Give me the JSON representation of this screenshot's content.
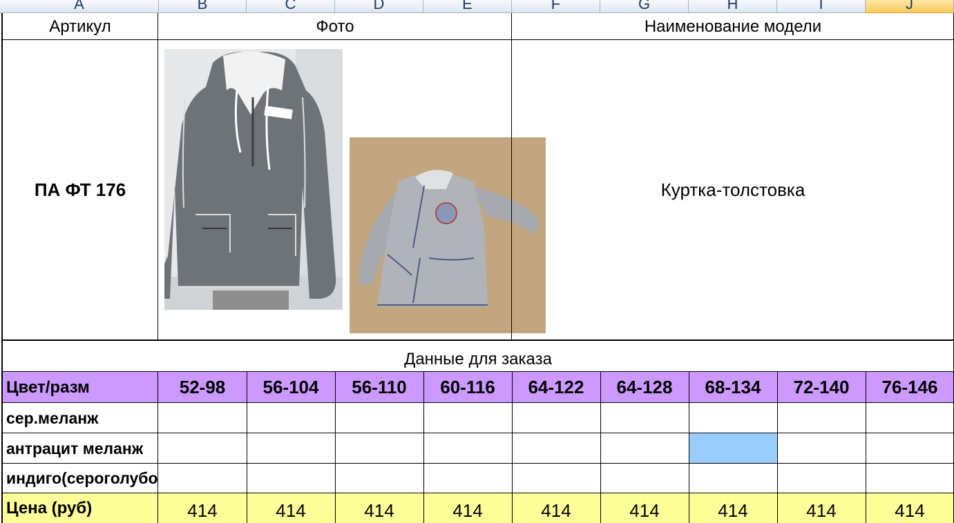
{
  "columns": [
    "A",
    "B",
    "C",
    "D",
    "E",
    "F",
    "G",
    "H",
    "I",
    "J"
  ],
  "selected_column": "J",
  "header": {
    "article": "Артикул",
    "photo": "Фото",
    "model_name": "Наименование модели"
  },
  "product": {
    "article": "ПА ФТ 176",
    "model_name": "Куртка-толстовка"
  },
  "order_title": "Данные для заказа",
  "size_header_label": "Цвет/разм",
  "sizes": [
    "52-98",
    "56-104",
    "56-110",
    "60-116",
    "64-122",
    "64-128",
    "68-134",
    "72-140",
    "76-146"
  ],
  "colors": [
    "сер.меланж",
    "антрацит меланж",
    "индиго(сероголубой)"
  ],
  "price_label": "Цена (руб)",
  "prices": [
    "414",
    "414",
    "414",
    "414",
    "414",
    "414",
    "414",
    "414",
    "414"
  ],
  "theme": {
    "size_row_bg": "#cc99ff",
    "price_row_bg": "#ffff99",
    "highlight_cell_bg": "#99ccff"
  }
}
